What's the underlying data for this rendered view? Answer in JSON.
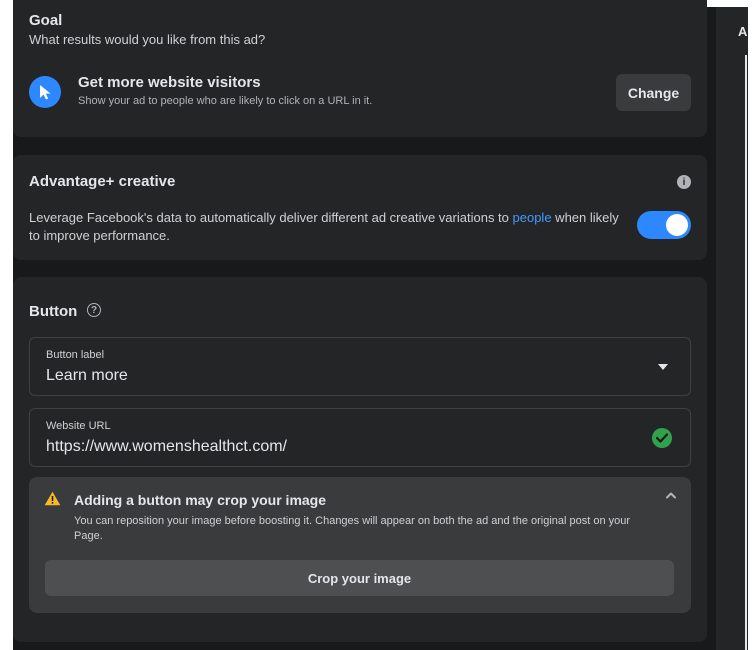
{
  "goal": {
    "title": "Goal",
    "subtitle": "What results would you like from this ad?",
    "option_title": "Get more website visitors",
    "option_desc": "Show your ad to people who are likely to click on a URL in it.",
    "change_label": "Change"
  },
  "advantage": {
    "title": "Advantage+ creative",
    "desc_before": "Leverage Facebook's data to automatically deliver different ad creative variations to ",
    "desc_link": "people",
    "desc_after": " when likely to improve performance.",
    "toggle_on": true
  },
  "button_section": {
    "title": "Button",
    "button_label_field": {
      "label": "Button label",
      "value": "Learn more"
    },
    "website_url_field": {
      "label": "Website URL",
      "value": "https://www.womenshealthct.com/"
    },
    "warning": {
      "title": "Adding a button may crop your image",
      "desc": "You can reposition your image before boosting it. Changes will appear on both the ad and the original post on your Page.",
      "crop_label": "Crop your image"
    }
  },
  "right_panel": {
    "letter": "A"
  },
  "colors": {
    "accent": "#2d88ff",
    "link": "#4599ff",
    "success": "#31a24c",
    "warning": "#f7b928",
    "card": "#242526"
  }
}
